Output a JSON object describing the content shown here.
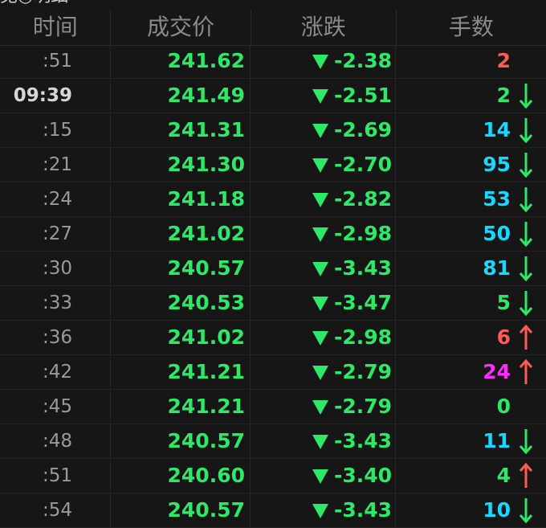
{
  "top_title_fragment": "见◎明细",
  "header": {
    "time": "时间",
    "price": "成交价",
    "change": "涨跌",
    "volume": "手数"
  },
  "colors": {
    "green": "#2ee86a",
    "red": "#ff5a55",
    "cyan": "#19d8ff",
    "magenta": "#ff2bff"
  },
  "rows": [
    {
      "time": ":51",
      "time_bold": false,
      "price": "241.62",
      "change": "-2.38",
      "volume": "2",
      "vol_color": "red",
      "arrow": "none"
    },
    {
      "time": "09:39",
      "time_bold": true,
      "price": "241.49",
      "change": "-2.51",
      "volume": "2",
      "vol_color": "green",
      "arrow": "down"
    },
    {
      "time": ":15",
      "time_bold": false,
      "price": "241.31",
      "change": "-2.69",
      "volume": "14",
      "vol_color": "cyan",
      "arrow": "down"
    },
    {
      "time": ":21",
      "time_bold": false,
      "price": "241.30",
      "change": "-2.70",
      "volume": "95",
      "vol_color": "cyan",
      "arrow": "down"
    },
    {
      "time": ":24",
      "time_bold": false,
      "price": "241.18",
      "change": "-2.82",
      "volume": "53",
      "vol_color": "cyan",
      "arrow": "down"
    },
    {
      "time": ":27",
      "time_bold": false,
      "price": "241.02",
      "change": "-2.98",
      "volume": "50",
      "vol_color": "cyan",
      "arrow": "down"
    },
    {
      "time": ":30",
      "time_bold": false,
      "price": "240.57",
      "change": "-3.43",
      "volume": "81",
      "vol_color": "cyan",
      "arrow": "down"
    },
    {
      "time": ":33",
      "time_bold": false,
      "price": "240.53",
      "change": "-3.47",
      "volume": "5",
      "vol_color": "green",
      "arrow": "down"
    },
    {
      "time": ":36",
      "time_bold": false,
      "price": "241.02",
      "change": "-2.98",
      "volume": "6",
      "vol_color": "red",
      "arrow": "up"
    },
    {
      "time": ":42",
      "time_bold": false,
      "price": "241.21",
      "change": "-2.79",
      "volume": "24",
      "vol_color": "magenta",
      "arrow": "up"
    },
    {
      "time": ":45",
      "time_bold": false,
      "price": "241.21",
      "change": "-2.79",
      "volume": "0",
      "vol_color": "green",
      "arrow": "none"
    },
    {
      "time": ":48",
      "time_bold": false,
      "price": "240.57",
      "change": "-3.43",
      "volume": "11",
      "vol_color": "cyan",
      "arrow": "down"
    },
    {
      "time": ":51",
      "time_bold": false,
      "price": "240.60",
      "change": "-3.40",
      "volume": "4",
      "vol_color": "green",
      "arrow": "up"
    },
    {
      "time": ":54",
      "time_bold": false,
      "price": "240.57",
      "change": "-3.43",
      "volume": "10",
      "vol_color": "cyan",
      "arrow": "down"
    }
  ]
}
